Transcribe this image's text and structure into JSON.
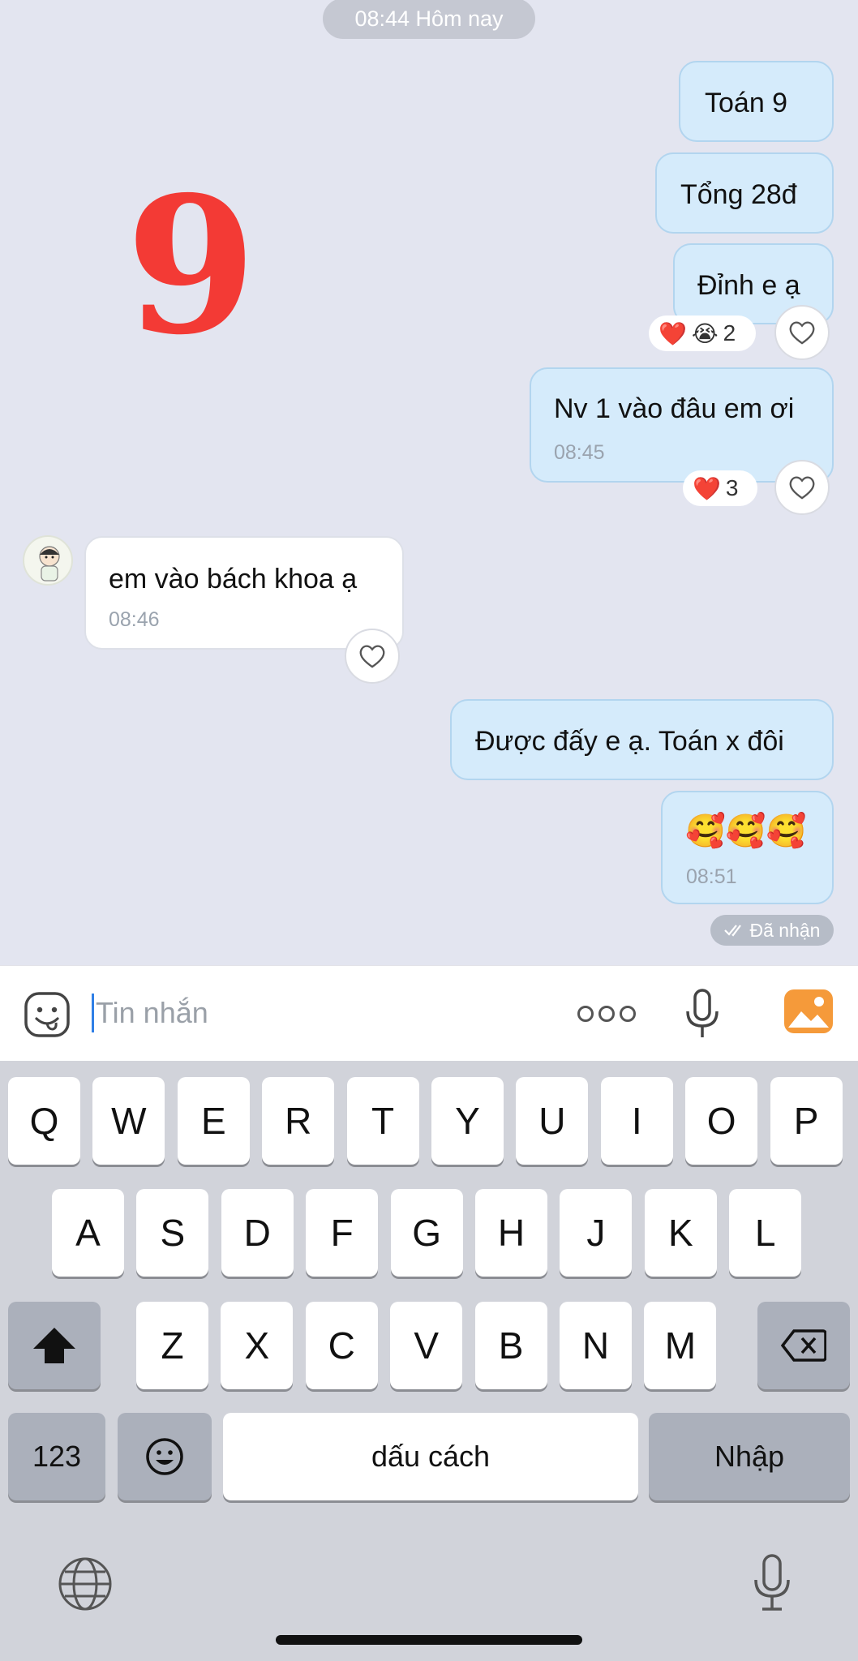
{
  "chat": {
    "date_label": "08:44 Hôm nay",
    "overlay_number": "9",
    "messages": [
      {
        "sender": "me",
        "text": "Toán 9"
      },
      {
        "sender": "me",
        "text": "Tổng 28đ"
      },
      {
        "sender": "me",
        "text": "Đỉnh e ạ",
        "reactions": {
          "emojis": [
            "❤️",
            "😭"
          ],
          "count": "2"
        }
      },
      {
        "sender": "me",
        "text": "Nv 1 vào đâu em ơi",
        "time": "08:45",
        "reactions": {
          "emojis": [
            "❤️"
          ],
          "count": "3"
        }
      },
      {
        "sender": "them",
        "text": "em vào bách khoa ạ",
        "time": "08:46"
      },
      {
        "sender": "me",
        "text": "Được đấy e ạ. Toán x đôi"
      },
      {
        "sender": "me",
        "text": "🥰🥰🥰",
        "time": "08:51"
      }
    ],
    "status": "Đã nhận"
  },
  "input": {
    "placeholder": "Tin nhắn"
  },
  "keyboard": {
    "row1": [
      "Q",
      "W",
      "E",
      "R",
      "T",
      "Y",
      "U",
      "I",
      "O",
      "P"
    ],
    "row2": [
      "A",
      "S",
      "D",
      "F",
      "G",
      "H",
      "J",
      "K",
      "L"
    ],
    "row3": [
      "Z",
      "X",
      "C",
      "V",
      "B",
      "N",
      "M"
    ],
    "numbers_key": "123",
    "space_key": "dấu cách",
    "return_key": "Nhập"
  }
}
